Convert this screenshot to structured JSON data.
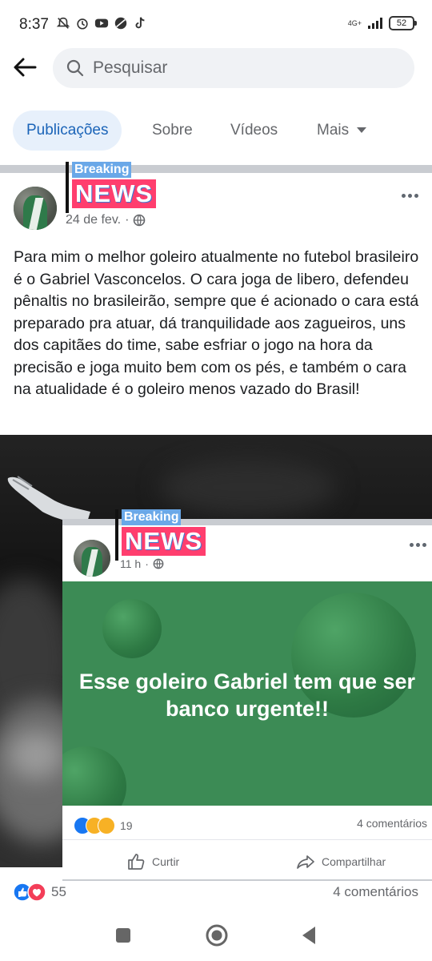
{
  "status_bar": {
    "time": "8:37",
    "network": "4G+",
    "battery": "52"
  },
  "search": {
    "placeholder": "Pesquisar"
  },
  "tabs": [
    {
      "label": "Publicações",
      "active": true
    },
    {
      "label": "Sobre"
    },
    {
      "label": "Vídeos"
    },
    {
      "label": "Mais"
    }
  ],
  "badge": {
    "top": "Breaking",
    "bottom": "NEWS"
  },
  "post": {
    "date": "24 de fev.",
    "text": "Para mim o melhor goleiro atualmente no futebol brasileiro é o Gabriel Vasconcelos.  O cara joga de libero, defendeu pênaltis no brasileirão, sempre que é acionado o cara está preparado pra atuar, dá tranquilidade aos zagueiros, uns dos capitães do time, sabe esfriar o jogo na hora da precisão e joga muito bem com os pés, e também  o cara na atualidade é o goleiro menos vazado do Brasil!",
    "reaction_count": "55",
    "comments": "4 comentários"
  },
  "shared_card": {
    "time": "11 h",
    "image_text": "Esse goleiro Gabriel tem que ser banco urgente!!",
    "reaction_count": "19",
    "comments": "4 comentários",
    "like_label": "Curtir",
    "share_label": "Compartilhar"
  },
  "colors": {
    "accent": "#1b64b8",
    "card_green": "#3c8b55",
    "badge_blue": "#6aa8e8",
    "badge_pink": "#ff3e6e"
  }
}
